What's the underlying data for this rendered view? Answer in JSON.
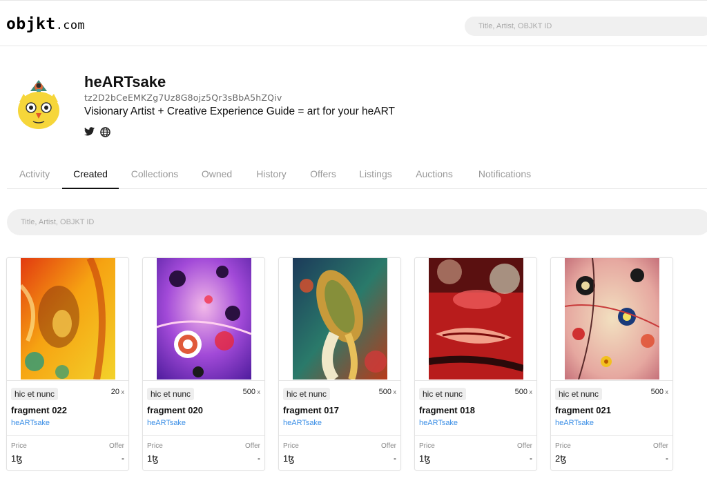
{
  "header": {
    "logo_main": "objkt",
    "logo_suffix": ".com",
    "search_placeholder": "Title, Artist, OBJKT ID"
  },
  "profile": {
    "name": "heARTsake",
    "address": "tz2D2bCeEMKZg7Uz8G8ojz5Qr3sBbA5hZQiv",
    "bio": "Visionary Artist + Creative Experience Guide = art for your heART",
    "social_icons": [
      "twitter-icon",
      "globe-icon"
    ]
  },
  "tabs": [
    {
      "label": "Activity",
      "active": false
    },
    {
      "label": "Created",
      "active": true
    },
    {
      "label": "Collections",
      "active": false
    },
    {
      "label": "Owned",
      "active": false
    },
    {
      "label": "History",
      "active": false
    },
    {
      "label": "Offers",
      "active": false
    },
    {
      "label": "Listings",
      "active": false
    },
    {
      "label": "Auctions",
      "active": false
    },
    {
      "label": "Notifications",
      "active": false
    }
  ],
  "main_search": {
    "placeholder": "Title, Artist, OBJKT ID"
  },
  "cards": [
    {
      "platform": "hic et nunc",
      "editions": "20",
      "title": "fragment 022",
      "creator": "heARTsake",
      "price_label": "Price",
      "offer_label": "Offer",
      "price": "1ꜩ",
      "offer": "-"
    },
    {
      "platform": "hic et nunc",
      "editions": "500",
      "title": "fragment 020",
      "creator": "heARTsake",
      "price_label": "Price",
      "offer_label": "Offer",
      "price": "1ꜩ",
      "offer": "-"
    },
    {
      "platform": "hic et nunc",
      "editions": "500",
      "title": "fragment 017",
      "creator": "heARTsake",
      "price_label": "Price",
      "offer_label": "Offer",
      "price": "1ꜩ",
      "offer": "-"
    },
    {
      "platform": "hic et nunc",
      "editions": "500",
      "title": "fragment 018",
      "creator": "heARTsake",
      "price_label": "Price",
      "offer_label": "Offer",
      "price": "1ꜩ",
      "offer": "-"
    },
    {
      "platform": "hic et nunc",
      "editions": "500",
      "title": "fragment 021",
      "creator": "heARTsake",
      "price_label": "Price",
      "offer_label": "Offer",
      "price": "2ꜩ",
      "offer": "-"
    }
  ],
  "colors": {
    "link": "#3a8ee6",
    "tab_inactive": "#999999",
    "tab_active": "#111111"
  }
}
